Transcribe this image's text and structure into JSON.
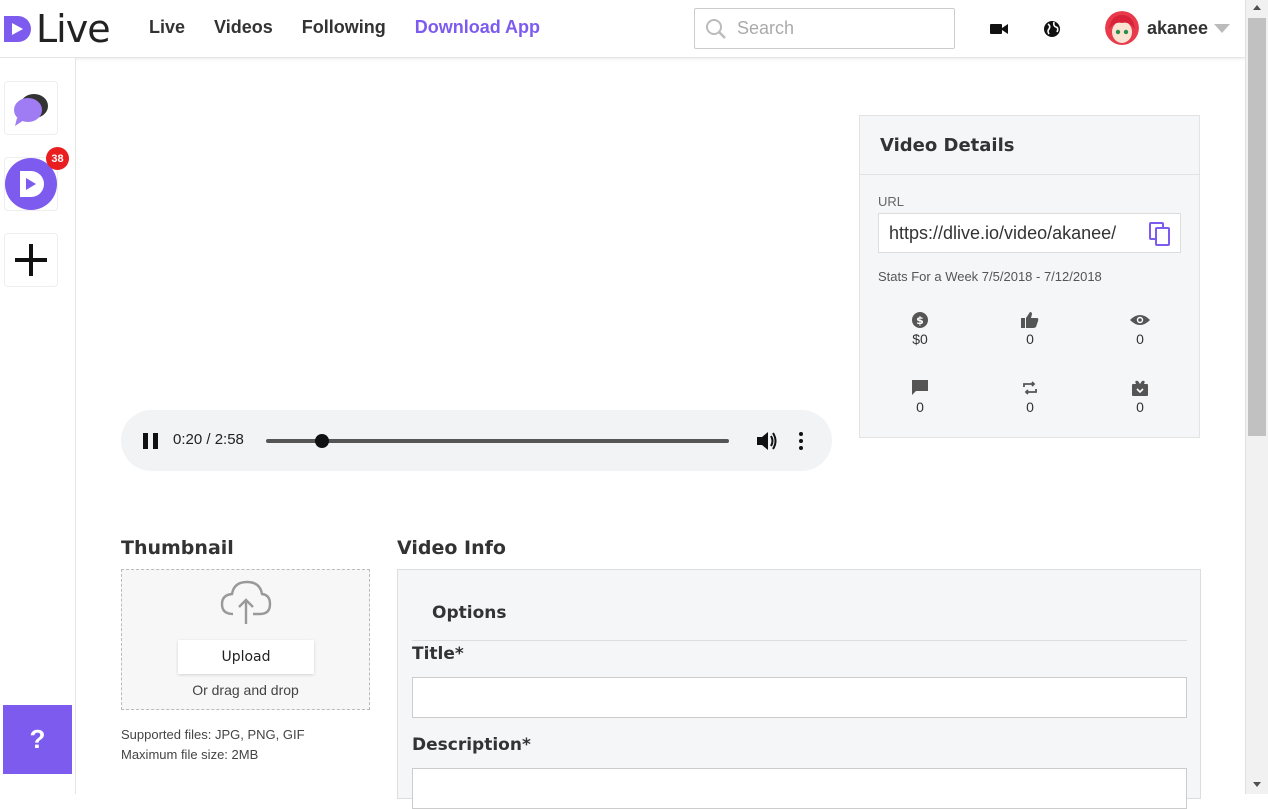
{
  "app": {
    "name": "Live",
    "accent": "#7e5bef"
  },
  "nav": {
    "live": "Live",
    "videos": "Videos",
    "following": "Following",
    "download": "Download App"
  },
  "search": {
    "placeholder": "Search"
  },
  "user": {
    "name": "akanee"
  },
  "rail": {
    "badge_count": "38",
    "help": "?"
  },
  "player": {
    "time": "0:20 / 2:58",
    "progress": 0.122
  },
  "details": {
    "title": "Video Details",
    "url_label": "URL",
    "url": "https://dlive.io/video/akanee/",
    "stats_label": "Stats For a Week 7/5/2018 - 7/12/2018",
    "stats": [
      {
        "icon": "dollar-icon",
        "value": "$0"
      },
      {
        "icon": "thumbs-up-icon",
        "value": "0"
      },
      {
        "icon": "eye-icon",
        "value": "0"
      },
      {
        "icon": "comment-icon",
        "value": "0"
      },
      {
        "icon": "repost-icon",
        "value": "0"
      },
      {
        "icon": "gift-icon",
        "value": "0"
      }
    ]
  },
  "thumbnail": {
    "heading": "Thumbnail",
    "upload": "Upload",
    "drag": "Or drag and drop",
    "supported": "Supported files: JPG, PNG, GIF",
    "max_size": "Maximum file size: 2MB"
  },
  "video_info": {
    "heading": "Video Info",
    "options": "Options",
    "title_label": "Title*",
    "description_label": "Description*"
  }
}
